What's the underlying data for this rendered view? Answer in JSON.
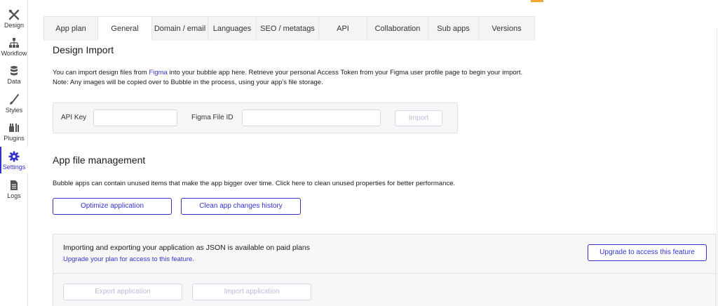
{
  "sidebar": {
    "items": [
      {
        "label": "Design",
        "icon": "design-tools-icon"
      },
      {
        "label": "Workflow",
        "icon": "workflow-icon"
      },
      {
        "label": "Data",
        "icon": "database-icon"
      },
      {
        "label": "Styles",
        "icon": "brush-icon"
      },
      {
        "label": "Plugins",
        "icon": "plugins-icon"
      },
      {
        "label": "Settings",
        "icon": "gear-icon",
        "active": true
      },
      {
        "label": "Logs",
        "icon": "document-icon"
      }
    ]
  },
  "tabs": [
    {
      "label": "App plan"
    },
    {
      "label": "General",
      "active": true
    },
    {
      "label": "Domain / email"
    },
    {
      "label": "Languages"
    },
    {
      "label": "SEO / metatags"
    },
    {
      "label": "API"
    },
    {
      "label": "Collaboration"
    },
    {
      "label": "Sub apps"
    },
    {
      "label": "Versions"
    }
  ],
  "design_import": {
    "title": "Design Import",
    "text_before_link": "You can import design files from ",
    "link_text": "Figma",
    "text_after_link": " into your bubble app here. Retrieve your personal Access Token from your Figma user profile page to begin your import.",
    "note": "Note: Any images will be copied over to Bubble in the process, using your app's file storage.",
    "api_key_label": "API Key",
    "api_key_value": "",
    "file_id_label": "Figma File ID",
    "file_id_value": "",
    "import_button": "Import"
  },
  "file_management": {
    "title": "App file management",
    "description": "Bubble apps can contain unused items that make the app bigger over time. Click here to clean unused properties for better performance.",
    "optimize_button": "Optimize application",
    "clean_history_button": "Clean app changes history"
  },
  "json_section": {
    "message": "Importing and exporting your application as JSON is available on paid plans",
    "upgrade_link": "Upgrade your plan for access to this feature.",
    "upgrade_button": "Upgrade to access this feature",
    "export_button": "Export application",
    "import_button": "Import application"
  },
  "colors": {
    "accent": "#3333cc",
    "topbar_accent": "#f2a533",
    "disabled": "#b9b9df"
  }
}
